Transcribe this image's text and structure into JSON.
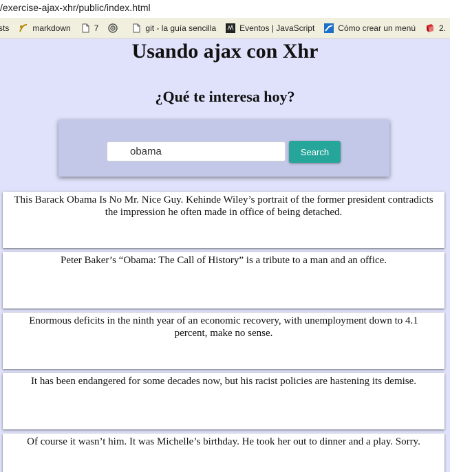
{
  "browser": {
    "url": "/exercise-ajax-xhr/public/index.html",
    "bookmarks": [
      {
        "icon": "list-icon",
        "label": "sts"
      },
      {
        "icon": "markdown-icon",
        "label": "markdown"
      },
      {
        "icon": "page-icon",
        "label": "7"
      },
      {
        "icon": "target-icon",
        "label": ""
      },
      {
        "icon": "page-icon",
        "label": "git - la guía sencilla"
      },
      {
        "icon": "events-icon",
        "label": "Eventos | JavaScript"
      },
      {
        "icon": "tutorial-icon",
        "label": "Cómo crear un menú"
      },
      {
        "icon": "book-icon",
        "label": "2."
      }
    ]
  },
  "page": {
    "title": "Usando ajax con Xhr",
    "subtitle": "¿Qué te interesa hoy?"
  },
  "search": {
    "value": "obama",
    "button_label": "Search"
  },
  "results": [
    "This Barack Obama Is No Mr. Nice Guy. Kehinde Wiley’s portrait of the former president contradicts the impression he often made in office of being detached.",
    "Peter Baker’s “Obama: The Call of History” is a tribute to a man and an office.",
    "Enormous deficits in the ninth year of an economic recovery, with unemployment down to 4.1 percent, make no sense.",
    "It has been endangered for some decades now, but his racist policies are hastening its demise.",
    "Of course it wasn’t him. It was Michelle’s birthday. He took her out to dinner and a play. Sorry."
  ],
  "colors": {
    "page_bg": "#e0e2fb",
    "panel_bg": "#c4c8e8",
    "button": "#26a69a"
  }
}
